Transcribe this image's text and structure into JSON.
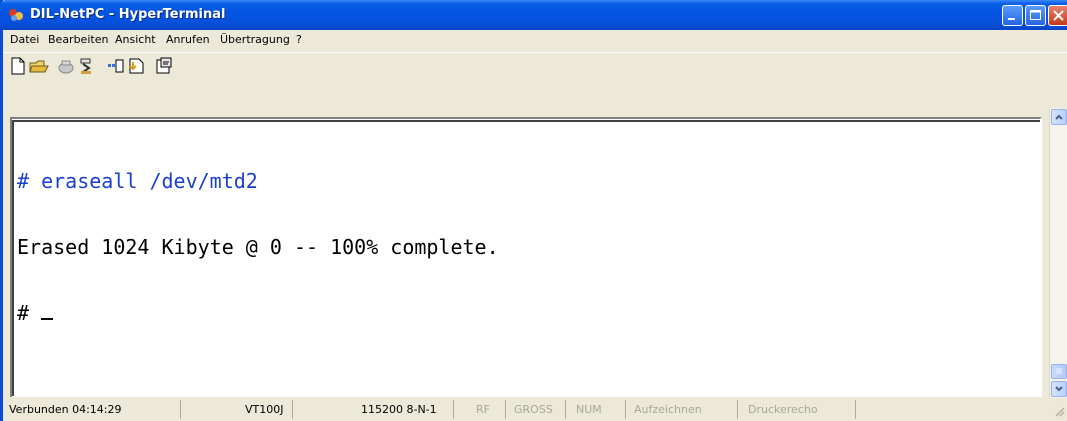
{
  "window": {
    "title": "DIL-NetPC - HyperTerminal"
  },
  "menu": {
    "items": [
      "Datei",
      "Bearbeiten",
      "Ansicht",
      "Anrufen",
      "Übertragung",
      "?"
    ]
  },
  "toolbar": {
    "icons": [
      "new-file-icon",
      "open-folder-icon",
      "phone-icon",
      "disconnect-icon",
      "send-icon",
      "receive-icon",
      "properties-icon"
    ]
  },
  "terminal": {
    "lines": [
      {
        "prompt": "# ",
        "text": "eraseall /dev/mtd2",
        "color": "#1a3fd0"
      },
      {
        "prompt": "",
        "text": "Erased 1024 Kibyte @ 0 -- 100% complete.",
        "color": "#000000"
      },
      {
        "prompt": "# ",
        "text": "",
        "color": "#000000"
      }
    ]
  },
  "status": {
    "connected": "Verbunden 04:14:29",
    "emulation": "VT100J",
    "port_settings": "115200 8-N-1",
    "rf": "RF",
    "gross": "GROSS",
    "num": "NUM",
    "capture": "Aufzeichnen",
    "print_echo": "Druckerecho"
  },
  "colors": {
    "titlebar": "#0454e3",
    "command": "#1a3fd0"
  }
}
